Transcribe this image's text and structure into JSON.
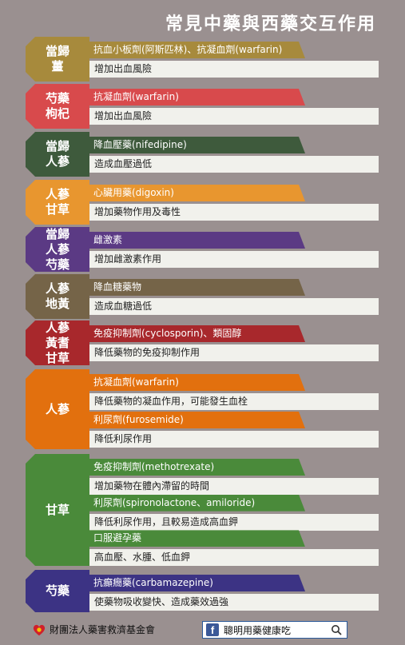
{
  "title": "常見中藥與西藥交互作用",
  "colors": {
    "background": "#9a9090",
    "effect_bg": "#f1f1ec"
  },
  "groups": [
    {
      "herb_lines": [
        "當歸",
        "薑"
      ],
      "color": "#a78a3c",
      "items": [
        {
          "drug": "抗血小板劑(阿斯匹林)、抗凝血劑(warfarin)",
          "effect": "增加出血風險"
        }
      ]
    },
    {
      "herb_lines": [
        "芍藥",
        "枸杞"
      ],
      "color": "#d84a4c",
      "items": [
        {
          "drug": "抗凝血劑(warfarin)",
          "effect": "增加出血風險"
        }
      ]
    },
    {
      "herb_lines": [
        "當歸",
        "人蔘"
      ],
      "color": "#3e5a3c",
      "items": [
        {
          "drug": "降血壓藥(nifedipine)",
          "effect": "造成血壓過低"
        }
      ]
    },
    {
      "herb_lines": [
        "人蔘",
        "甘草"
      ],
      "color": "#e8962f",
      "items": [
        {
          "drug": "心臟用藥(digoxin)",
          "effect": "增加藥物作用及毒性"
        }
      ]
    },
    {
      "herb_lines": [
        "當歸",
        "人蔘",
        "芍藥"
      ],
      "color": "#5b3a84",
      "items": [
        {
          "drug": "雌激素",
          "effect": "增加雌激素作用"
        }
      ]
    },
    {
      "herb_lines": [
        "人蔘",
        "地黃"
      ],
      "color": "#756448",
      "items": [
        {
          "drug": "降血糖藥物",
          "effect": "造成血糖過低"
        }
      ]
    },
    {
      "herb_lines": [
        "人蔘",
        "黃耆",
        "甘草"
      ],
      "color": "#a8282c",
      "items": [
        {
          "drug": "免疫抑制劑(cyclosporin)、類固醇",
          "effect": "降低藥物的免疫抑制作用"
        }
      ]
    },
    {
      "herb_lines": [
        "人蔘"
      ],
      "color": "#e2700e",
      "items": [
        {
          "drug": "抗凝血劑(warfarin)",
          "effect": "降低藥物的凝血作用，可能發生血栓"
        },
        {
          "drug": "利尿劑(furosemide)",
          "effect": "降低利尿作用"
        }
      ]
    },
    {
      "herb_lines": [
        "甘草"
      ],
      "color": "#4a8a3a",
      "items": [
        {
          "drug": "免疫抑制劑(methotrexate)",
          "effect": "增加藥物在體內滯留的時間"
        },
        {
          "drug": "利尿劑(spironolactone、amiloride)",
          "effect": "降低利尿作用，且較易造成高血鉀"
        },
        {
          "drug": "口服避孕藥",
          "effect": "高血壓、水腫、低血鉀"
        }
      ]
    },
    {
      "herb_lines": [
        "芍藥"
      ],
      "color": "#3c3384",
      "items": [
        {
          "drug": "抗癲癇藥(carbamazepine)",
          "effect": "使藥物吸收變快、造成藥效過強"
        }
      ]
    }
  ],
  "footer": {
    "org_name": "財團法人藥害救濟基金會",
    "fb_label": "聰明用藥健康吃",
    "fb_icon": "facebook-icon",
    "search_icon": "search-icon",
    "logo_icon": "heart-logo-icon"
  }
}
